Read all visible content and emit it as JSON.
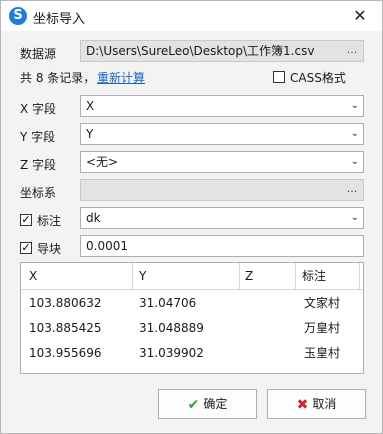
{
  "window": {
    "title": "坐标导入",
    "app_icon_glyph": "S",
    "close_glyph": "✕"
  },
  "source": {
    "label": "数据源",
    "path": "D:\\Users\\SureLeo\\Desktop\\工作簿1.csv",
    "browse": "..."
  },
  "record": {
    "text": "共 8 条记录，",
    "recalc": "重新计算"
  },
  "cass": {
    "label": "CASS格式",
    "checked": false
  },
  "x_field": {
    "label": "X 字段",
    "value": "X"
  },
  "y_field": {
    "label": "Y 字段",
    "value": "Y"
  },
  "z_field": {
    "label": "Z 字段",
    "value": "<无>"
  },
  "coord_system": {
    "label": "坐标系",
    "value": "",
    "browse": "..."
  },
  "annotation": {
    "label": "标注",
    "checked": true,
    "value": "dk"
  },
  "snap": {
    "label": "导块",
    "checked": true,
    "value": "0.0001"
  },
  "table": {
    "columns": [
      "X",
      "Y",
      "Z",
      "标注"
    ],
    "rows": [
      [
        "103.880632",
        "31.04706",
        "",
        "文家村"
      ],
      [
        "103.885425",
        "31.048889",
        "",
        "万皇村"
      ],
      [
        "103.955696",
        "31.039902",
        "",
        "玉皇村"
      ]
    ]
  },
  "buttons": {
    "ok": "确定",
    "cancel": "取消",
    "ok_glyph": "✔",
    "cancel_glyph": "✖"
  },
  "colors": {
    "ok_icon": "#2e9e3e",
    "cancel_icon": "#d3232f",
    "link": "#1565c0",
    "app_icon": "#1f7fd6"
  },
  "icons": {
    "dropdown": "chevron-down-icon",
    "check": "checkmark-icon"
  }
}
